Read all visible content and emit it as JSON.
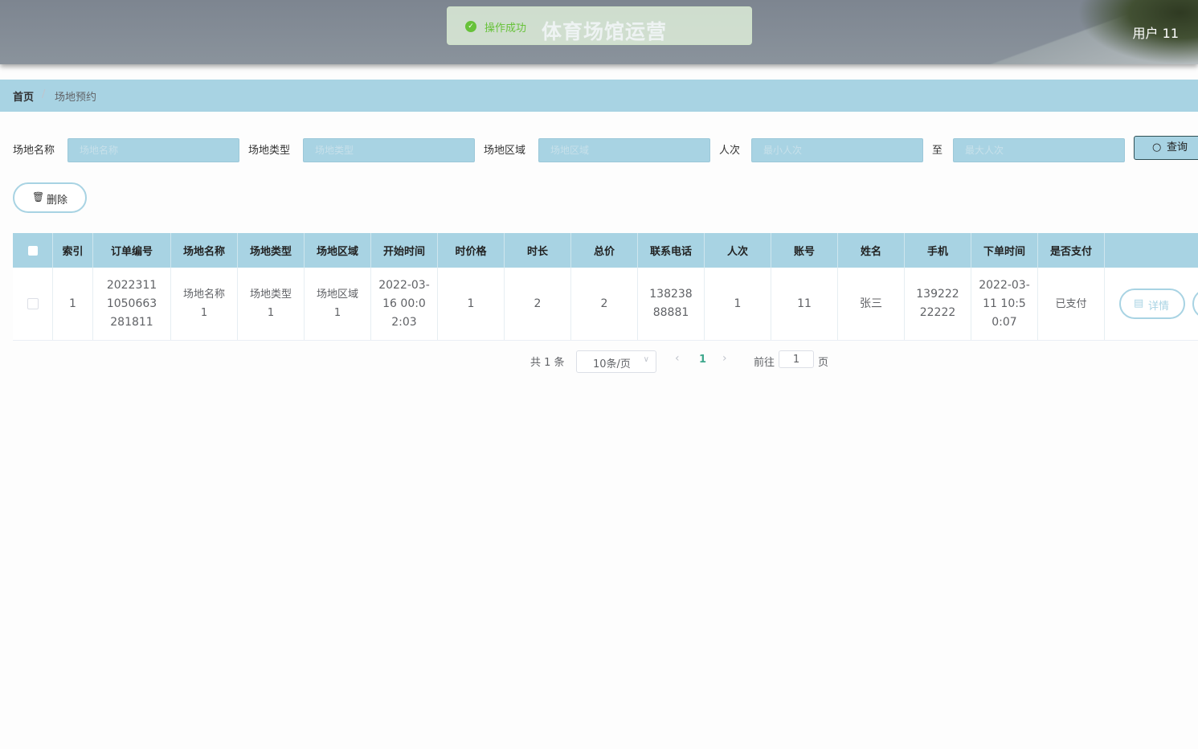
{
  "header": {
    "title": "体育场馆运营",
    "user": "用户 11"
  },
  "toast": {
    "text": "操作成功",
    "icon": "check-circle-icon",
    "color": "#67c23a"
  },
  "breadcrumb": {
    "home": "首页",
    "separator": "/",
    "current": "场地预约"
  },
  "filters": {
    "venue_name": {
      "label": "场地名称",
      "placeholder": "场地名称"
    },
    "venue_type": {
      "label": "场地类型",
      "placeholder": "场地类型"
    },
    "venue_area": {
      "label": "场地区域",
      "placeholder": "场地区域"
    },
    "people": {
      "label": "人次",
      "placeholder_min": "最小人次",
      "separator": "至",
      "placeholder_max": "最大人次"
    },
    "search_label": "查询"
  },
  "actions": {
    "delete_label": "删除"
  },
  "table": {
    "headers": [
      "索引",
      "订单编号",
      "场地名称",
      "场地类型",
      "场地区域",
      "开始时间",
      "时价格",
      "时长",
      "总价",
      "联系电话",
      "人次",
      "账号",
      "姓名",
      "手机",
      "下单时间",
      "是否支付"
    ],
    "rows": [
      {
        "index": "1",
        "order_no": "20223111050663281811",
        "venue_name": "场地名称1",
        "venue_type": "场地类型1",
        "venue_area": "场地区域1",
        "start_time": "2022-03-16 00:02:03",
        "hour_price": "1",
        "duration": "2",
        "total": "2",
        "phone": "13823888881",
        "people": "1",
        "account": "11",
        "name": "张三",
        "mobile": "13922222222",
        "order_time": "2022-03-11 10:50:07",
        "paid": "已支付",
        "detail_label": "详情"
      }
    ]
  },
  "pagination": {
    "total": "共 1 条",
    "page_size": "10条/页",
    "current_page": "1",
    "goto_label": "前往",
    "goto_value": "1",
    "page_suffix": "页"
  },
  "colors": {
    "accent": "#a8d3e3",
    "header": "#7d8590",
    "active_page": "#3fa88d"
  }
}
